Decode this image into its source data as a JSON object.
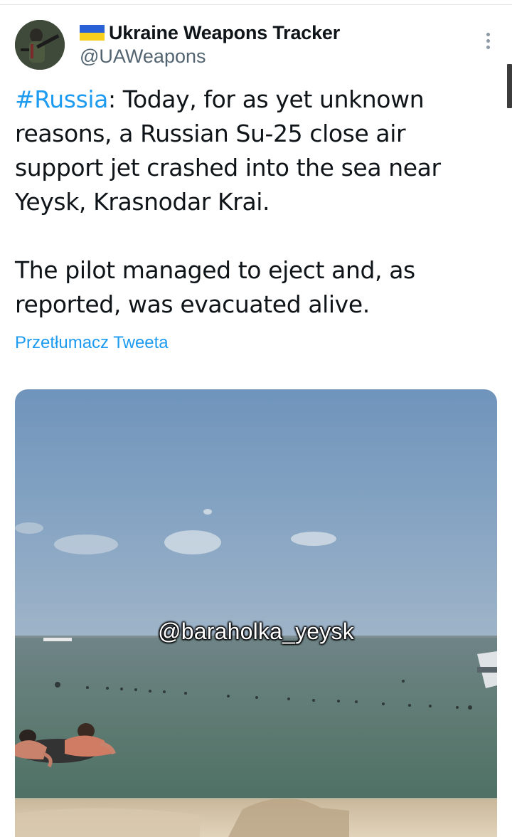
{
  "tweet": {
    "display_name": "Ukraine Weapons Tracker",
    "handle": "@UAWeapons",
    "hashtag": "#Russia",
    "text_rest": ": Today, for as yet unknown reasons, a Russian Su-25 close air support jet crashed into the sea near Yeysk, Krasnodar Krai.",
    "text_second": "The pilot managed to eject and, as reported, was evacuated alive.",
    "translate_label": "Przetłumacz Tweeta"
  },
  "media": {
    "watermark": "@baraholka_yeysk"
  },
  "icons": {
    "flag": "ukraine-flag-icon",
    "more": "more-options-icon"
  },
  "colors": {
    "link": "#1d9bf0",
    "text": "#0f1419",
    "muted": "#536471"
  }
}
